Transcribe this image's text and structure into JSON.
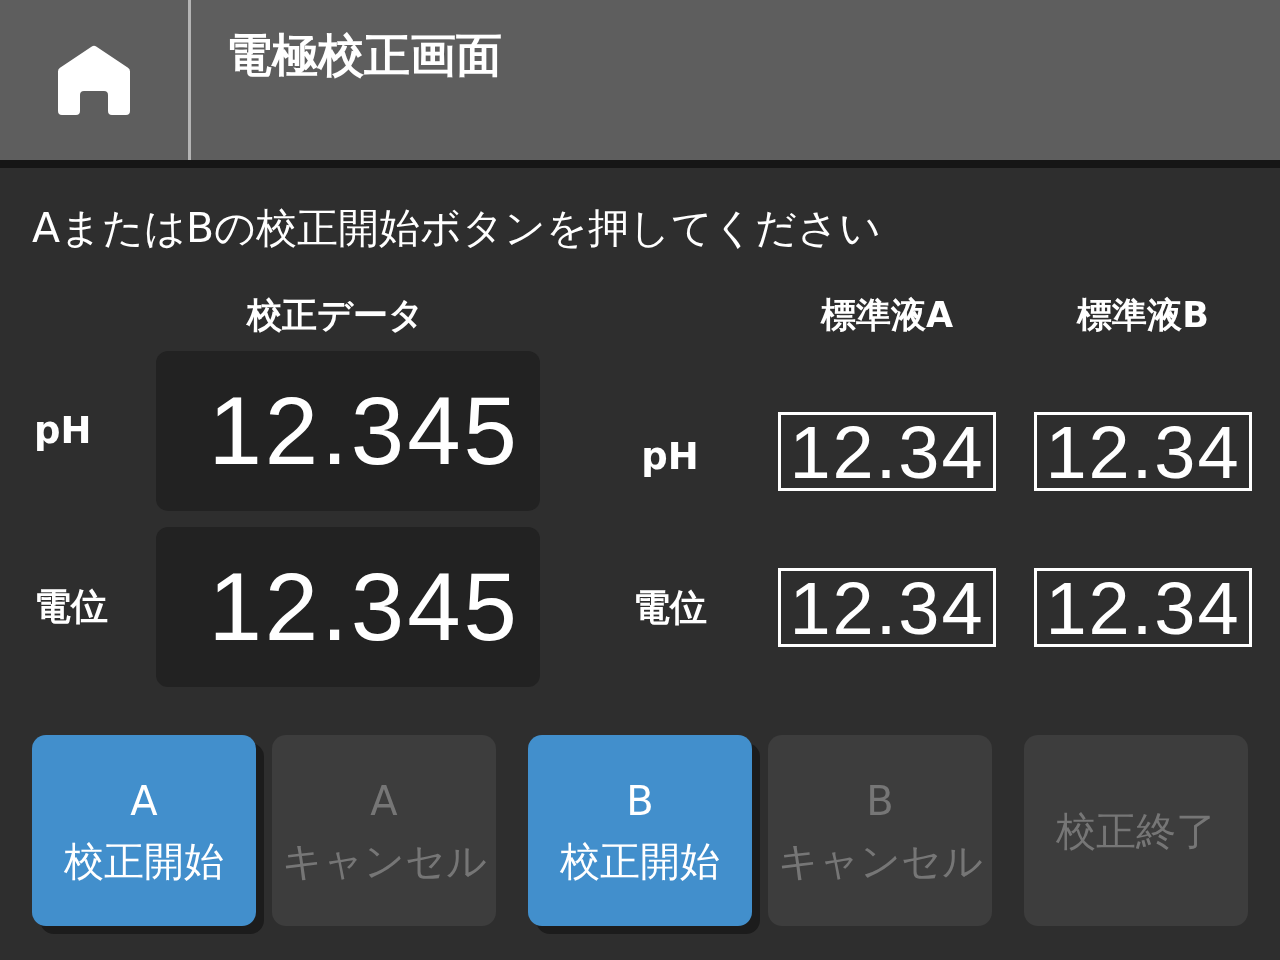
{
  "header": {
    "title": "電極校正画面"
  },
  "instruction": "AまたはBの校正開始ボタンを押してください",
  "calibration_data": {
    "heading": "校正データ",
    "rows": [
      {
        "label": "pH",
        "value": "12.345"
      },
      {
        "label": "電位",
        "value": "12.345"
      }
    ]
  },
  "standards": {
    "columns": [
      "標準液A",
      "標準液B"
    ],
    "rows": [
      {
        "label": "pH",
        "values": [
          "12.34",
          "12.34"
        ]
      },
      {
        "label": "電位",
        "values": [
          "12.34",
          "12.34"
        ]
      }
    ]
  },
  "buttons": [
    {
      "letter": "A",
      "label": "校正開始",
      "disabled": false
    },
    {
      "letter": "A",
      "label": "キャンセル",
      "disabled": true
    },
    {
      "letter": "B",
      "label": "校正開始",
      "disabled": false
    },
    {
      "letter": "B",
      "label": "キャンセル",
      "disabled": true
    },
    {
      "label": "校正終了",
      "disabled": true
    }
  ]
}
